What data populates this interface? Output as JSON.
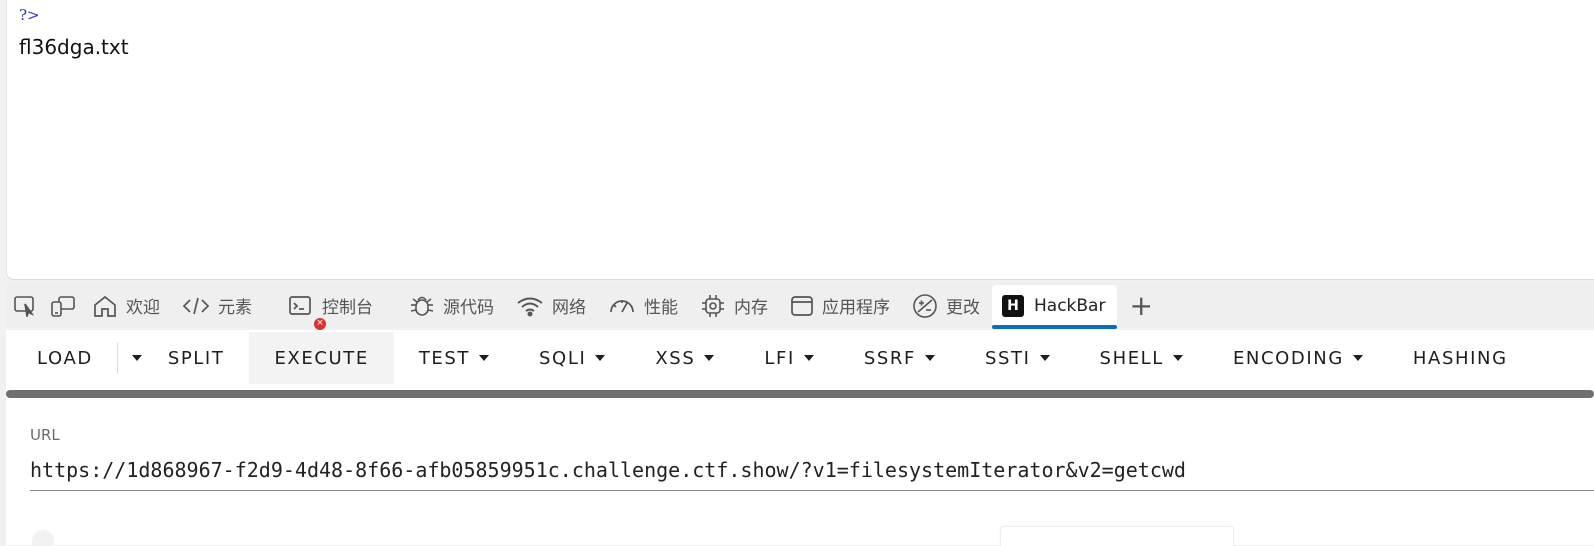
{
  "page": {
    "php_close_tag": "?>",
    "output_text": "fl36dga.txt"
  },
  "devtools": {
    "tabs": [
      {
        "label": "欢迎",
        "icon": "home-icon"
      },
      {
        "label": "元素",
        "icon": "code-icon"
      },
      {
        "label": "控制台",
        "icon": "console-icon"
      },
      {
        "label": "源代码",
        "icon": "bug-icon"
      },
      {
        "label": "网络",
        "icon": "wifi-icon"
      },
      {
        "label": "性能",
        "icon": "speedometer-icon"
      },
      {
        "label": "内存",
        "icon": "chip-icon"
      },
      {
        "label": "应用程序",
        "icon": "window-icon"
      },
      {
        "label": "更改",
        "icon": "changes-icon"
      },
      {
        "label": "HackBar",
        "icon": "hackbar-logo-icon",
        "active": true
      }
    ],
    "hackbar_logo_letter": "H",
    "console_error_badge": "×",
    "add_tab_glyph": "+"
  },
  "hackbar": {
    "toolbar": {
      "load": "LOAD",
      "split": "SPLIT",
      "execute": "EXECUTE",
      "test": "TEST",
      "sqli": "SQLI",
      "xss": "XSS",
      "lfi": "LFI",
      "ssrf": "SSRF",
      "ssti": "SSTI",
      "shell": "SHELL",
      "encoding": "ENCODING",
      "hashing": "HASHING"
    },
    "url_label": "URL",
    "url_value": "https://1d868967-f2d9-4d48-8f66-afb05859951c.challenge.ctf.show/?v1=filesystemIterator&v2=getcwd"
  },
  "colors": {
    "active_tab_underline": "#0f6cbd",
    "error_badge": "#d9312b",
    "php_tag": "#3232c8"
  }
}
